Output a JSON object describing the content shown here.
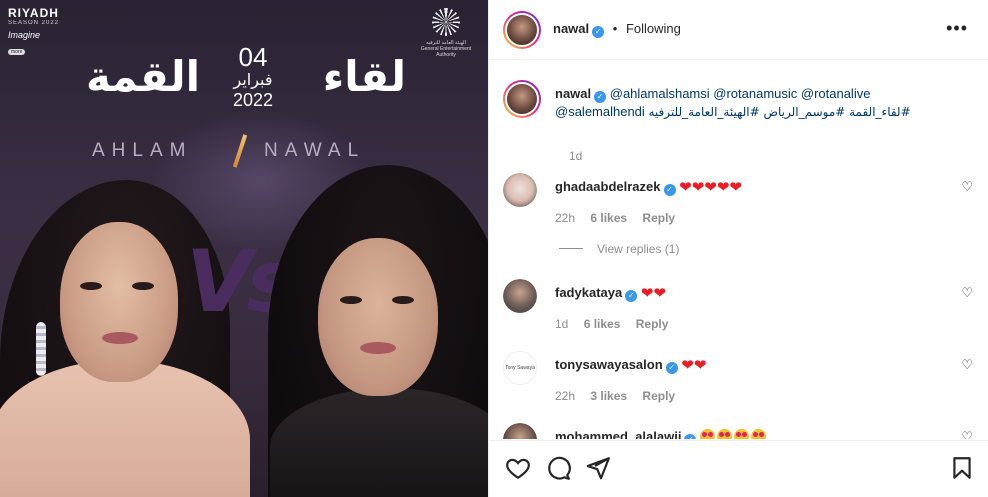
{
  "image": {
    "brand_left": {
      "name": "RIYADH",
      "sub": "SEASON 2022",
      "tag": "Imagine",
      "badge": "more"
    },
    "brand_right": {
      "caption": "الهيئة العامة للترفيه General Entertainment Authority"
    },
    "title_word1": "لقاء",
    "title_word2": "القمة",
    "date_day": "04",
    "date_month": "فبراير",
    "date_year": "2022",
    "name_left": "AHLAM",
    "name_right": "NAWAL",
    "vs": "Vs"
  },
  "header": {
    "username": "nawal",
    "separator": "•",
    "follow_status": "Following",
    "more": "•••"
  },
  "caption": {
    "username": "nawal",
    "mentions": "@ahlamalshamsi @rotanamusic @rotanalive",
    "mentions2": "@salemalhendi",
    "hashtags_ar": "#لقاء_القمة #موسم_الرياض #الهيئة_العامة_للترفيه",
    "time": "1d"
  },
  "comments": [
    {
      "username": "ghadaabdelrazek",
      "text": "❤❤❤❤❤",
      "time": "22h",
      "likes": "6 likes",
      "reply": "Reply"
    },
    {
      "username": "fadykataya",
      "text": "❤❤",
      "time": "1d",
      "likes": "6 likes",
      "reply": "Reply"
    },
    {
      "username": "tonysawayasalon",
      "text": "❤❤",
      "time": "22h",
      "likes": "3 likes",
      "reply": "Reply"
    },
    {
      "username": "mohammed_alalawii",
      "text": "",
      "emoji_count": 4
    }
  ],
  "view_replies": "View replies (1)",
  "avatar_labels": {
    "tony": "Tony Sawaya"
  }
}
